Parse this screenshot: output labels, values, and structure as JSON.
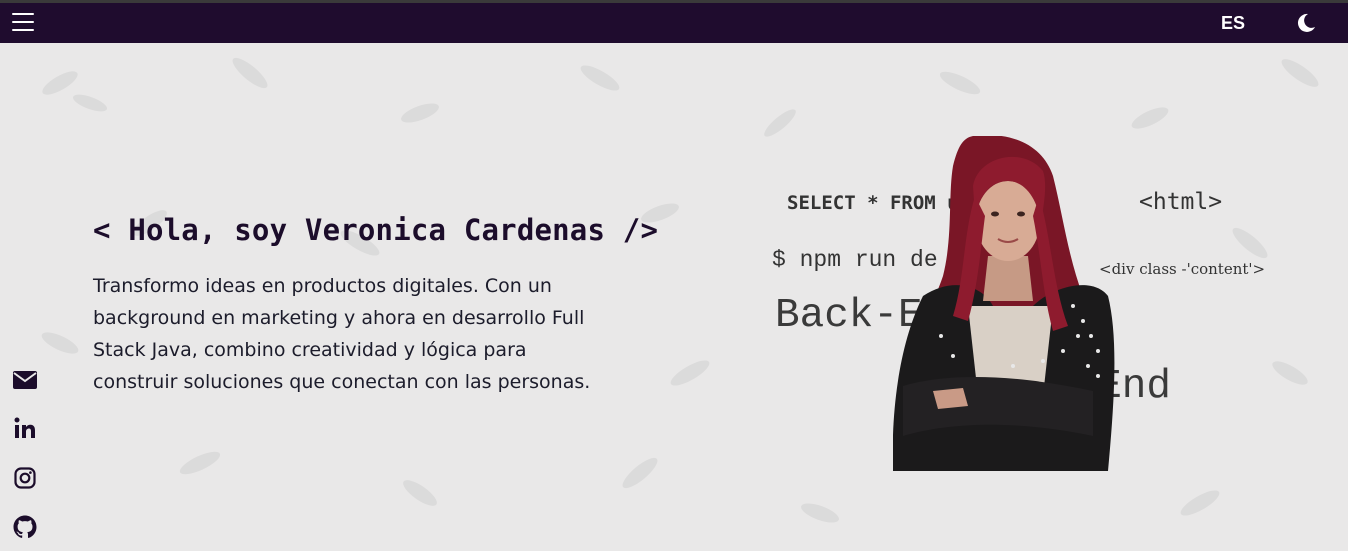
{
  "navbar": {
    "menu_icon": "hamburger-icon",
    "language": "ES",
    "theme_icon": "moon-icon",
    "background_color": "#1f0c2e"
  },
  "hero": {
    "title": "< Hola, soy Veronica Cardenas />",
    "description": "Transformo ideas en productos digitales. Con un background en marketing y ahora en desarrollo Full Stack Java, combino creatividad y lógica para construir soluciones que conectan con las personas."
  },
  "social": [
    {
      "icon": "envelope-icon"
    },
    {
      "icon": "linkedin-icon"
    },
    {
      "icon": "instagram-icon"
    },
    {
      "icon": "github-icon"
    }
  ],
  "code_background": {
    "sql": "SELECT * FROM u",
    "html": "<html>",
    "npm": "$ npm run de",
    "div": "<div class -'content'>",
    "backend": "Back-E",
    "frontend": "t-End",
    "tail": "t"
  },
  "colors": {
    "page_background": "#e9e8e8",
    "text": "#1c0d2b",
    "hair": "#8e1b2e"
  }
}
